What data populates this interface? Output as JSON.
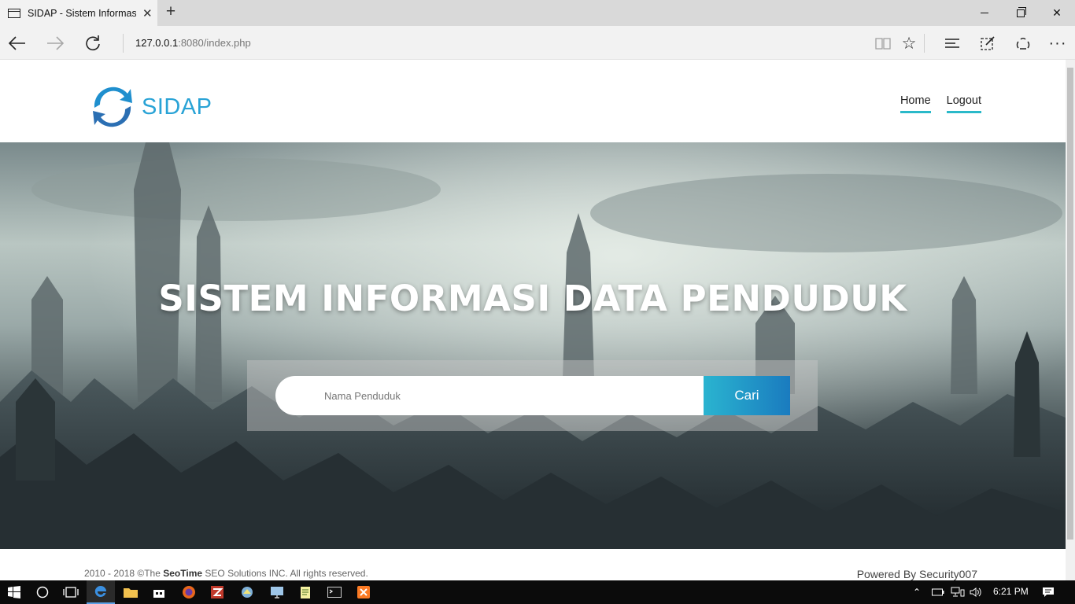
{
  "browser": {
    "tab_title": "SIDAP - Sistem Informasi",
    "url_host": "127.0.0.1",
    "url_rest": ":8080/index.php"
  },
  "site": {
    "logo_text": "SIDAP",
    "menu": [
      "Home",
      "Logout"
    ],
    "hero_title": "SISTEM INFORMASI DATA PENDUDUK",
    "search_placeholder": "Nama Penduduk",
    "search_button": "Cari"
  },
  "footer": {
    "copyright_prefix": "2010 - 2018 ©The ",
    "copyright_brand": "SeoTime",
    "copyright_suffix": " SEO Solutions INC. All rights reserved.",
    "powered": "Powered By Security007"
  },
  "taskbar": {
    "clock": "6:21 PM"
  },
  "colors": {
    "accent": "#2ab9c9",
    "logo": "#29a3d6",
    "button_start": "#2ab4d0",
    "button_end": "#1a7bbf"
  }
}
